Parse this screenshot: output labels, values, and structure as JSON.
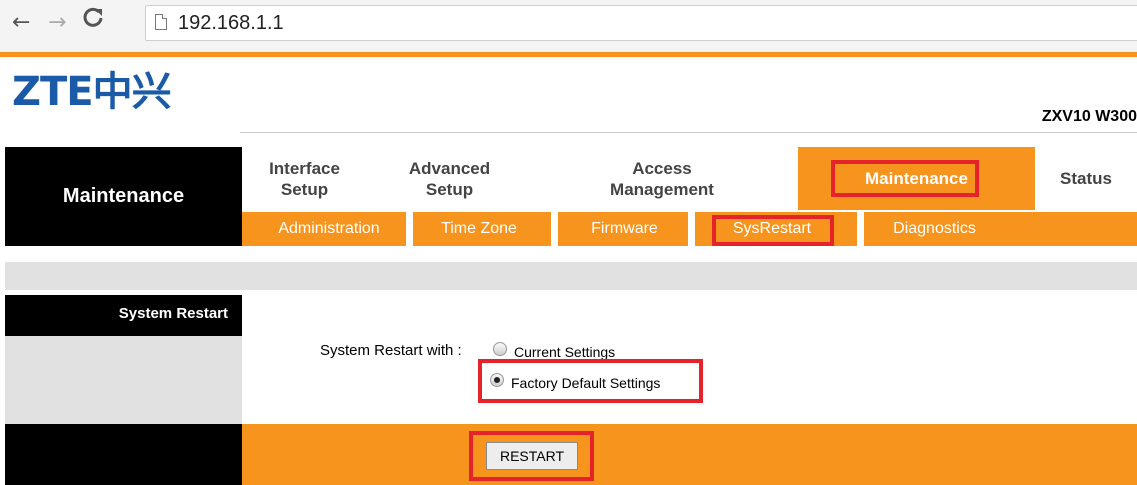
{
  "browser": {
    "back_icon": "arrow-left",
    "forward_icon": "arrow-right",
    "reload_icon": "reload",
    "page_icon": "page",
    "url": "192.168.1.1"
  },
  "header": {
    "logo_text": "ZTE中兴",
    "model": "ZXV10 W300"
  },
  "nav": {
    "section_title": "Maintenance",
    "tabs": [
      {
        "label_line1": "Interface",
        "label_line2": "Setup"
      },
      {
        "label_line1": "Advanced",
        "label_line2": "Setup"
      },
      {
        "label_line1": "Access",
        "label_line2": "Management"
      },
      {
        "label_line1": "Maintenance",
        "label_line2": ""
      },
      {
        "label_line1": "Status",
        "label_line2": ""
      }
    ],
    "active_tab": "Maintenance",
    "subtabs": [
      "Administration",
      "Time Zone",
      "Firmware",
      "SysRestart",
      "Diagnostics"
    ],
    "active_subtab": "SysRestart"
  },
  "content": {
    "panel_title": "System Restart",
    "restart_with_label": "System Restart with :",
    "options": [
      {
        "label": "Current Settings",
        "checked": false
      },
      {
        "label": "Factory Default Settings",
        "checked": true
      }
    ],
    "restart_button": "RESTART"
  },
  "colors": {
    "accent_orange": "#f7941d",
    "highlight_red": "#e5232b",
    "logo_blue": "#1a5aa6"
  }
}
